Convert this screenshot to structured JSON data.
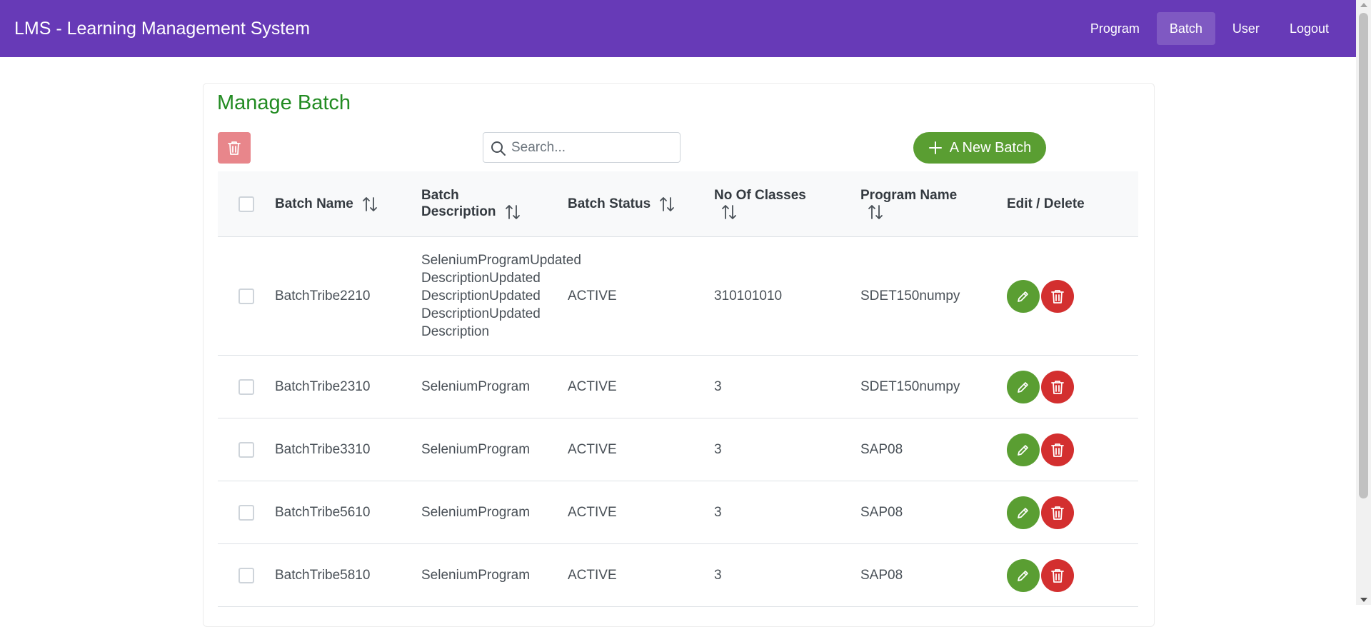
{
  "app": {
    "title": "LMS - Learning Management System"
  },
  "nav": {
    "items": [
      {
        "label": "Program",
        "active": false
      },
      {
        "label": "Batch",
        "active": true
      },
      {
        "label": "User",
        "active": false
      },
      {
        "label": "Logout",
        "active": false
      }
    ]
  },
  "page": {
    "title": "Manage Batch",
    "search_placeholder": "Search...",
    "new_batch_label": "A New Batch"
  },
  "table": {
    "headers": {
      "batch_name": "Batch Name",
      "batch_description_line1": "Batch",
      "batch_description_line2": "Description",
      "batch_status": "Batch Status",
      "no_of_classes": "No Of Classes",
      "program_name": "Program Name",
      "edit_delete": "Edit / Delete"
    },
    "rows": [
      {
        "name": "BatchTribe2210",
        "description_lines": [
          "SeleniumProgramUpdated",
          "DescriptionUpdated",
          "DescriptionUpdated",
          "DescriptionUpdated",
          "Description"
        ],
        "status": "ACTIVE",
        "classes": "310101010",
        "program": "SDET150numpy"
      },
      {
        "name": "BatchTribe2310",
        "description": "SeleniumProgram",
        "status": "ACTIVE",
        "classes": "3",
        "program": "SDET150numpy"
      },
      {
        "name": "BatchTribe3310",
        "description": "SeleniumProgram",
        "status": "ACTIVE",
        "classes": "3",
        "program": "SAP08"
      },
      {
        "name": "BatchTribe5610",
        "description": "SeleniumProgram",
        "status": "ACTIVE",
        "classes": "3",
        "program": "SAP08"
      },
      {
        "name": "BatchTribe5810",
        "description": "SeleniumProgram",
        "status": "ACTIVE",
        "classes": "3",
        "program": "SAP08"
      }
    ]
  },
  "colors": {
    "topbar": "#673ab7",
    "title": "#228b22",
    "edit": "#5a9e32",
    "delete": "#d32f2f",
    "bulk_delete": "#e8868b"
  },
  "icons": {
    "search": "search-icon",
    "plus": "plus-icon",
    "sort": "sort-icon",
    "edit": "pencil-icon",
    "delete": "trash-icon"
  }
}
